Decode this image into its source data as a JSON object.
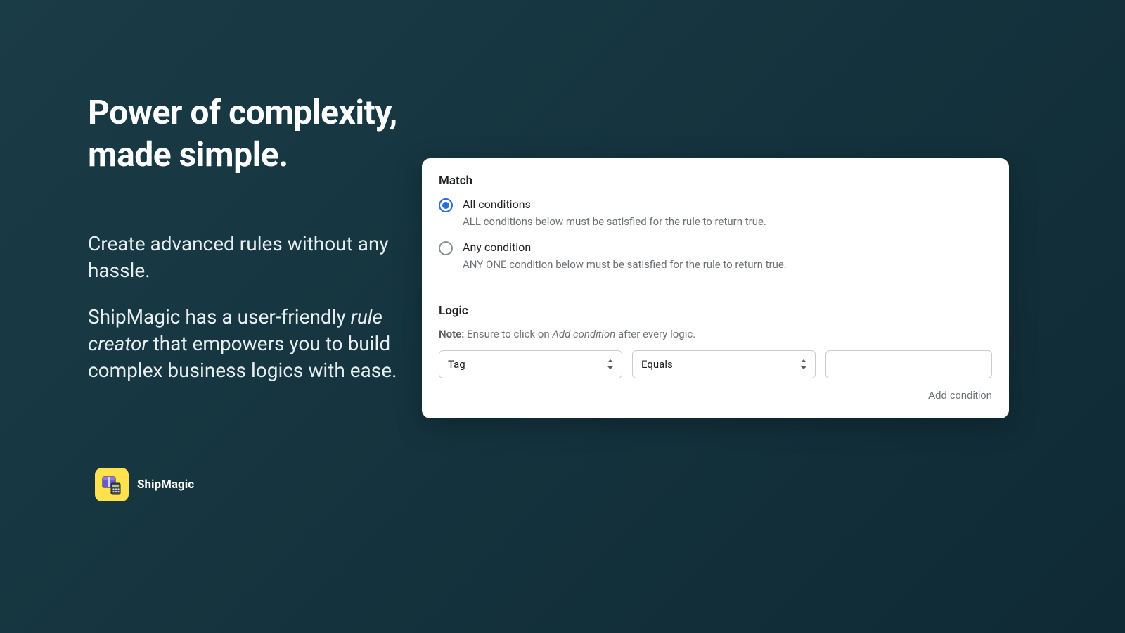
{
  "hero": {
    "title_line1": "Power of complexity,",
    "title_line2": "made simple.",
    "subtitle1": "Create advanced rules without any hassle.",
    "subtitle2_pre": "ShipMagic has a user-friendly ",
    "subtitle2_em": "rule creator",
    "subtitle2_post": " that empowers you to build complex business logics with ease."
  },
  "brand": {
    "name": "ShipMagic"
  },
  "card": {
    "match": {
      "title": "Match",
      "options": [
        {
          "label": "All conditions",
          "desc": "ALL conditions below must be satisfied for the rule to return true.",
          "selected": true
        },
        {
          "label": "Any condition",
          "desc": "ANY ONE condition below must be satisfied for the rule to return true.",
          "selected": false
        }
      ]
    },
    "logic": {
      "title": "Logic",
      "note_label": "Note:",
      "note_pre": " Ensure to click on ",
      "note_em": "Add condition",
      "note_post": " after every logic.",
      "field_select_value": "Tag",
      "operator_select_value": "Equals",
      "value_input": "",
      "add_condition_label": "Add condition"
    }
  }
}
